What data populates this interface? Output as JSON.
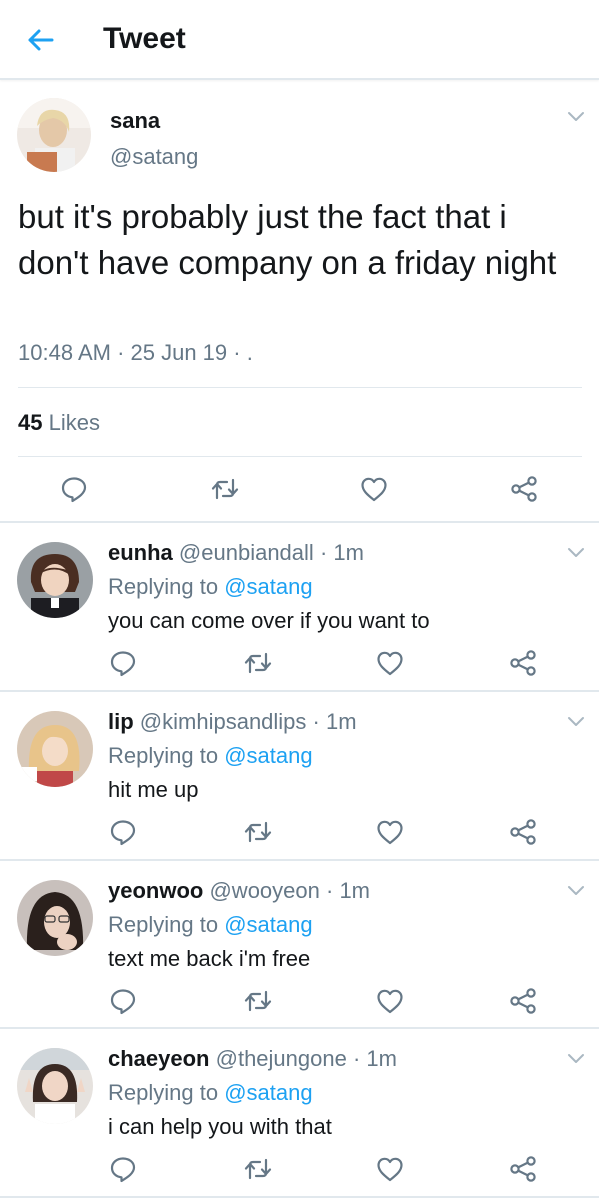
{
  "header": {
    "title": "Tweet"
  },
  "tweet": {
    "name": "sana",
    "handle": "@satang",
    "text": "but it's probably just the fact that i don't have company on a friday night",
    "meta": "10:48 AM · 25 Jun 19 · .",
    "likes_count": "45",
    "likes_label": "Likes"
  },
  "replies": [
    {
      "name": "eunha",
      "handle": "@eunbiandall",
      "time": "· 1m",
      "replying_label": "Replying to",
      "mention": "@satang",
      "text": "you can come over if you want to"
    },
    {
      "name": "lip",
      "handle": "@kimhipsandlips",
      "time": "· 1m",
      "replying_label": "Replying to",
      "mention": "@satang",
      "text": "hit me up"
    },
    {
      "name": "yeonwoo",
      "handle": "@wooyeon",
      "time": "· 1m",
      "replying_label": "Replying to",
      "mention": "@satang",
      "text": "text me back i'm free"
    },
    {
      "name": "chaeyeon",
      "handle": "@thejungone",
      "time": "· 1m",
      "replying_label": "Replying to",
      "mention": "@satang",
      "text": "i can help you with that"
    }
  ],
  "colors": {
    "accent": "#1da1f2",
    "secondary_text": "#657786",
    "divider": "#e1e8ed"
  },
  "icons": [
    "back-arrow-icon",
    "chevron-down-icon",
    "reply-icon",
    "retweet-icon",
    "like-icon",
    "share-icon"
  ]
}
